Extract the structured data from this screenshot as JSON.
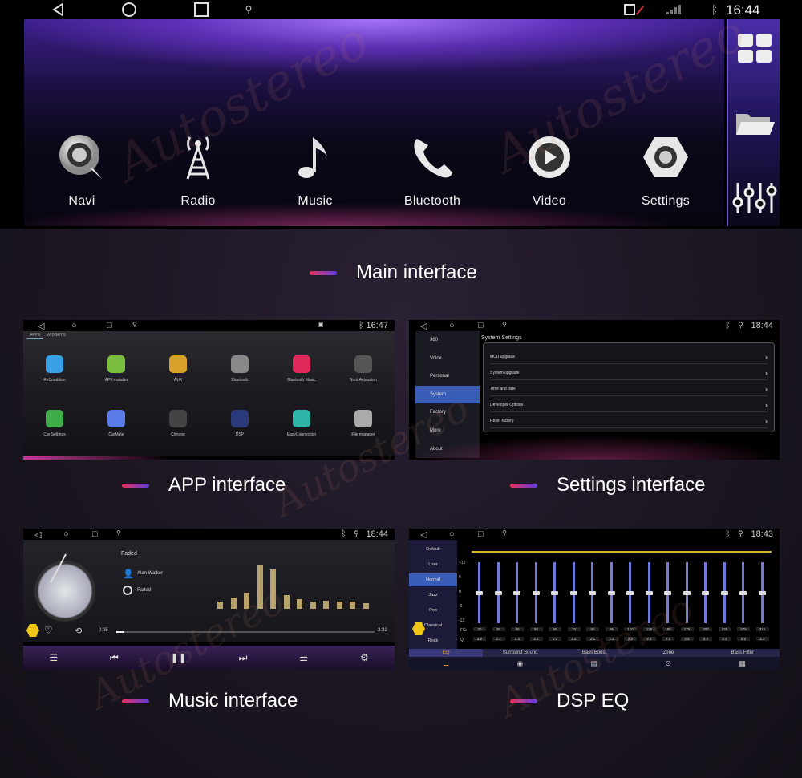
{
  "main": {
    "time": "16:44",
    "apps": [
      {
        "label": "Navi",
        "icon": "navi-icon"
      },
      {
        "label": "Radio",
        "icon": "radio-tower-icon"
      },
      {
        "label": "Music",
        "icon": "music-note-icon"
      },
      {
        "label": "Bluetooth",
        "icon": "phone-icon"
      },
      {
        "label": "Video",
        "icon": "play-icon"
      },
      {
        "label": "Settings",
        "icon": "gear-icon"
      }
    ],
    "caption": "Main interface"
  },
  "app_screen": {
    "time": "16:47",
    "tabs": [
      "APPS",
      "WIDGETS"
    ],
    "apps": [
      {
        "label": "AirCondition",
        "color": "#3aa0e8"
      },
      {
        "label": "APK installer",
        "color": "#7bbf3f"
      },
      {
        "label": "AUX",
        "color": "#d8a22a"
      },
      {
        "label": "Bluetooth",
        "color": "#888888"
      },
      {
        "label": "Bluetooth Music",
        "color": "#e0285a"
      },
      {
        "label": "Boot Animation",
        "color": "#555555"
      },
      {
        "label": "Car Settings",
        "color": "#3fae4a"
      },
      {
        "label": "CarMate",
        "color": "#5a7be8"
      },
      {
        "label": "Chrome",
        "color": "#444444"
      },
      {
        "label": "DSP",
        "color": "#2a3a7a"
      },
      {
        "label": "EasyConnection",
        "color": "#2fb5a8"
      },
      {
        "label": "File manager",
        "color": "#aaaaaa"
      }
    ],
    "caption": "APP interface"
  },
  "settings_screen": {
    "time": "18:44",
    "title": "System Settings",
    "menu": [
      "360",
      "Voice",
      "Personal",
      "System",
      "Factory",
      "More",
      "About"
    ],
    "active": "System",
    "rows": [
      "MCU upgrade",
      "System upgrade",
      "Time and date",
      "Developer Options",
      "Reset factory"
    ],
    "caption": "Settings interface"
  },
  "music_screen": {
    "time": "18:44",
    "song": "Faded",
    "artist": "Alan Walker",
    "album": "Faded",
    "elapsed": "0:05",
    "total": "3:32",
    "progress": 0.03,
    "spectrum": [
      0.15,
      0.25,
      0.35,
      0.95,
      0.85,
      0.3,
      0.2,
      0.15,
      0.18,
      0.15,
      0.15,
      0.12
    ],
    "caption": "Music interface"
  },
  "dsp_screen": {
    "time": "18:43",
    "presets": [
      "Default",
      "User",
      "Normal",
      "Jazz",
      "Pop",
      "Classical",
      "Rock"
    ],
    "active": "Normal",
    "fc": [
      "20",
      "30",
      "40",
      "50",
      "60",
      "70",
      "80",
      "95",
      "110",
      "125",
      "150",
      "175",
      "200",
      "235",
      "275",
      "315"
    ],
    "q": [
      "2.2",
      "2.2",
      "2.2",
      "2.2",
      "2.2",
      "2.2",
      "2.2",
      "2.2",
      "2.2",
      "2.2",
      "2.2",
      "2.2",
      "2.2",
      "2.2",
      "2.2",
      "2.2"
    ],
    "scale": [
      "+12",
      "6",
      "0",
      "-6",
      "-12"
    ],
    "fc_label": "FC:",
    "q_label": "Q:",
    "tabs": [
      "EQ",
      "Surround Sound",
      "Bass Boost",
      "Zone",
      "Bass Filter"
    ],
    "caption": "DSP EQ"
  },
  "watermark": "Autostereo"
}
